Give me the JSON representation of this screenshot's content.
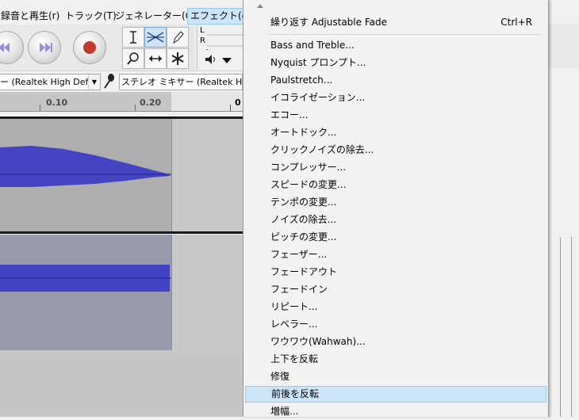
{
  "menubar": {
    "items": [
      {
        "label": "録音と再生(r)",
        "active": false
      },
      {
        "label": "トラック(T)",
        "active": false
      },
      {
        "label": "ジェネレーター(G)",
        "active": false
      },
      {
        "label": "エフェクト(c)",
        "active": true
      }
    ]
  },
  "toolbar": {
    "meter_l": "L",
    "meter_r": "R"
  },
  "devices": {
    "output": "ー (Realtek High Def",
    "input": "ステレオ ミキサー (Realtek Hig"
  },
  "ruler": {
    "ticks": [
      "0.10",
      "0.20",
      "0"
    ]
  },
  "menu": {
    "repeat_label": "繰り返す Adjustable Fade",
    "repeat_shortcut": "Ctrl+R",
    "items": [
      "Bass and Treble...",
      "Nyquist プロンプト...",
      "Paulstretch...",
      "イコライゼーション...",
      "エコー...",
      "オートドック...",
      "クリックノイズの除去...",
      "コンプレッサー...",
      "スピードの変更...",
      "テンポの変更...",
      "ノイズの除去...",
      "ピッチの変更...",
      "フェーザー...",
      "フェードアウト",
      "フェードイン",
      "リピート...",
      "レベラー...",
      "ワウワウ(Wahwah)...",
      "上下を反転",
      "修復",
      "前後を反転",
      "増幅..."
    ],
    "highlighted_index": 20
  },
  "colors": {
    "waveform": "#3232c8",
    "menu_highlight": "#cce4f7",
    "record": "#c0392b",
    "transport": "#9a8ad8"
  }
}
